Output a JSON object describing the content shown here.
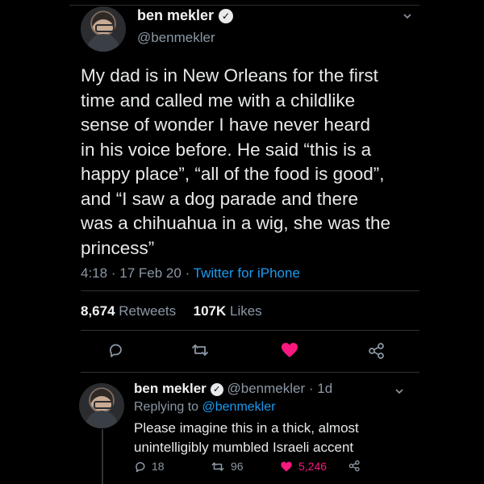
{
  "tweet": {
    "name": "ben mekler",
    "handle": "@benmekler",
    "text": "My dad is in New Orleans for the first\ntime and called me with a childlike\nsense of wonder I have never heard\nin his voice before. He said “this is a\nhappy place”, “all of the food is good”,\nand “I saw a dog parade and there\nwas a chihuahua in a wig, she was the\nprincess”",
    "time": "4:18",
    "date": "17 Feb 20",
    "source": "Twitter for iPhone",
    "retweets_count": "8,674",
    "retweets_label": "Retweets",
    "likes_count": "107K",
    "likes_label": "Likes"
  },
  "reply": {
    "name": "ben mekler",
    "handle": "@benmekler",
    "age": "1d",
    "replying_prefix": "Replying to",
    "replying_to": "@benmekler",
    "text": "Please imagine this in a thick, almost\nunintelligibly mumbled Israeli accent",
    "reply_count": "18",
    "retweet_count": "96",
    "like_count": "5,246"
  },
  "icons": {
    "verified": "verified-badge-icon",
    "reply": "reply-icon",
    "retweet": "retweet-icon",
    "like": "heart-icon",
    "share": "share-icon",
    "more": "chevron-down-icon"
  },
  "colors": {
    "background": "#000000",
    "text": "#e7e9ea",
    "secondary": "#8b98a5",
    "link": "#1d9bf0",
    "like": "#f91880"
  }
}
